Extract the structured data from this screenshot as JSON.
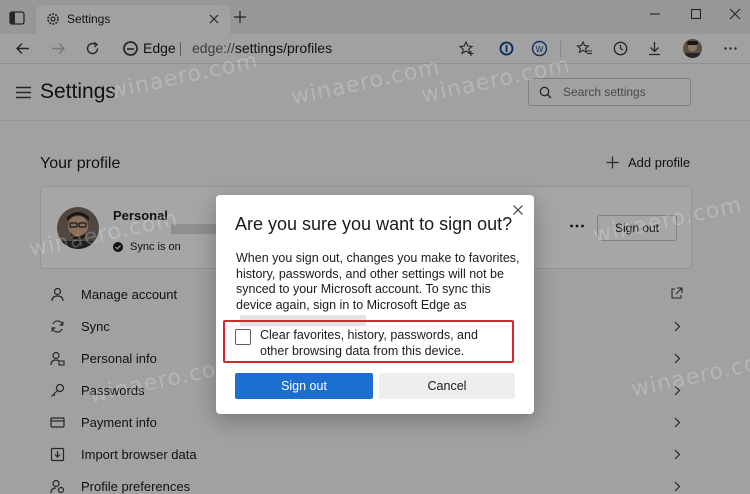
{
  "browser": {
    "tab": {
      "title": "Settings"
    },
    "address": {
      "brand": "Edge",
      "url_scheme": "edge://",
      "url_path": "settings/profiles"
    }
  },
  "settings": {
    "title": "Settings",
    "search_placeholder": "Search settings",
    "section_title": "Your profile",
    "add_profile_label": "Add profile",
    "profile": {
      "name": "Personal",
      "sync_status": "Sync is on",
      "sign_out_label": "Sign out"
    },
    "menu": [
      {
        "label": "Manage account",
        "icon": "person-icon",
        "trailing": "external-link-icon"
      },
      {
        "label": "Sync",
        "icon": "sync-icon",
        "trailing": "chevron-right-icon"
      },
      {
        "label": "Personal info",
        "icon": "personal-info-icon",
        "trailing": "chevron-right-icon"
      },
      {
        "label": "Passwords",
        "icon": "key-icon",
        "trailing": "chevron-right-icon"
      },
      {
        "label": "Payment info",
        "icon": "credit-card-icon",
        "trailing": "chevron-right-icon"
      },
      {
        "label": "Import browser data",
        "icon": "import-icon",
        "trailing": "chevron-right-icon"
      },
      {
        "label": "Profile preferences",
        "icon": "preferences-icon",
        "trailing": "chevron-right-icon"
      }
    ]
  },
  "dialog": {
    "title": "Are you sure you want to sign out?",
    "body": "When you sign out, changes you make to favorites, history, passwords, and other settings will not be synced to your Microsoft account. To sync this device again, sign in to Microsoft Edge as",
    "checkbox_label": "Clear favorites, history, passwords, and other browsing data from this device.",
    "checkbox_checked": false,
    "confirm_label": "Sign out",
    "cancel_label": "Cancel"
  },
  "watermark_text": "winaero.com",
  "colors": {
    "accent": "#1a6fd1",
    "highlight_border": "#d7262d",
    "sync_ok": "#1b1b1b"
  }
}
